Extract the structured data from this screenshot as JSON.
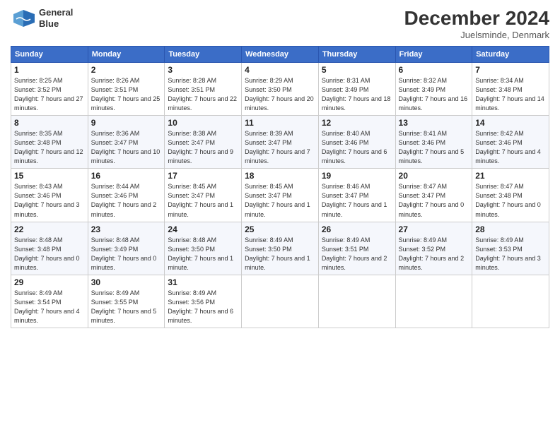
{
  "header": {
    "title": "December 2024",
    "subtitle": "Juelsminde, Denmark",
    "logo_line1": "General",
    "logo_line2": "Blue"
  },
  "days_of_week": [
    "Sunday",
    "Monday",
    "Tuesday",
    "Wednesday",
    "Thursday",
    "Friday",
    "Saturday"
  ],
  "weeks": [
    [
      {
        "day": "1",
        "sunrise": "8:25 AM",
        "sunset": "3:52 PM",
        "daylight": "7 hours and 27 minutes."
      },
      {
        "day": "2",
        "sunrise": "8:26 AM",
        "sunset": "3:51 PM",
        "daylight": "7 hours and 25 minutes."
      },
      {
        "day": "3",
        "sunrise": "8:28 AM",
        "sunset": "3:51 PM",
        "daylight": "7 hours and 22 minutes."
      },
      {
        "day": "4",
        "sunrise": "8:29 AM",
        "sunset": "3:50 PM",
        "daylight": "7 hours and 20 minutes."
      },
      {
        "day": "5",
        "sunrise": "8:31 AM",
        "sunset": "3:49 PM",
        "daylight": "7 hours and 18 minutes."
      },
      {
        "day": "6",
        "sunrise": "8:32 AM",
        "sunset": "3:49 PM",
        "daylight": "7 hours and 16 minutes."
      },
      {
        "day": "7",
        "sunrise": "8:34 AM",
        "sunset": "3:48 PM",
        "daylight": "7 hours and 14 minutes."
      }
    ],
    [
      {
        "day": "8",
        "sunrise": "8:35 AM",
        "sunset": "3:48 PM",
        "daylight": "7 hours and 12 minutes."
      },
      {
        "day": "9",
        "sunrise": "8:36 AM",
        "sunset": "3:47 PM",
        "daylight": "7 hours and 10 minutes."
      },
      {
        "day": "10",
        "sunrise": "8:38 AM",
        "sunset": "3:47 PM",
        "daylight": "7 hours and 9 minutes."
      },
      {
        "day": "11",
        "sunrise": "8:39 AM",
        "sunset": "3:47 PM",
        "daylight": "7 hours and 7 minutes."
      },
      {
        "day": "12",
        "sunrise": "8:40 AM",
        "sunset": "3:46 PM",
        "daylight": "7 hours and 6 minutes."
      },
      {
        "day": "13",
        "sunrise": "8:41 AM",
        "sunset": "3:46 PM",
        "daylight": "7 hours and 5 minutes."
      },
      {
        "day": "14",
        "sunrise": "8:42 AM",
        "sunset": "3:46 PM",
        "daylight": "7 hours and 4 minutes."
      }
    ],
    [
      {
        "day": "15",
        "sunrise": "8:43 AM",
        "sunset": "3:46 PM",
        "daylight": "7 hours and 3 minutes."
      },
      {
        "day": "16",
        "sunrise": "8:44 AM",
        "sunset": "3:46 PM",
        "daylight": "7 hours and 2 minutes."
      },
      {
        "day": "17",
        "sunrise": "8:45 AM",
        "sunset": "3:47 PM",
        "daylight": "7 hours and 1 minute."
      },
      {
        "day": "18",
        "sunrise": "8:45 AM",
        "sunset": "3:47 PM",
        "daylight": "7 hours and 1 minute."
      },
      {
        "day": "19",
        "sunrise": "8:46 AM",
        "sunset": "3:47 PM",
        "daylight": "7 hours and 1 minute."
      },
      {
        "day": "20",
        "sunrise": "8:47 AM",
        "sunset": "3:47 PM",
        "daylight": "7 hours and 0 minutes."
      },
      {
        "day": "21",
        "sunrise": "8:47 AM",
        "sunset": "3:48 PM",
        "daylight": "7 hours and 0 minutes."
      }
    ],
    [
      {
        "day": "22",
        "sunrise": "8:48 AM",
        "sunset": "3:48 PM",
        "daylight": "7 hours and 0 minutes."
      },
      {
        "day": "23",
        "sunrise": "8:48 AM",
        "sunset": "3:49 PM",
        "daylight": "7 hours and 0 minutes."
      },
      {
        "day": "24",
        "sunrise": "8:48 AM",
        "sunset": "3:50 PM",
        "daylight": "7 hours and 1 minute."
      },
      {
        "day": "25",
        "sunrise": "8:49 AM",
        "sunset": "3:50 PM",
        "daylight": "7 hours and 1 minute."
      },
      {
        "day": "26",
        "sunrise": "8:49 AM",
        "sunset": "3:51 PM",
        "daylight": "7 hours and 2 minutes."
      },
      {
        "day": "27",
        "sunrise": "8:49 AM",
        "sunset": "3:52 PM",
        "daylight": "7 hours and 2 minutes."
      },
      {
        "day": "28",
        "sunrise": "8:49 AM",
        "sunset": "3:53 PM",
        "daylight": "7 hours and 3 minutes."
      }
    ],
    [
      {
        "day": "29",
        "sunrise": "8:49 AM",
        "sunset": "3:54 PM",
        "daylight": "7 hours and 4 minutes."
      },
      {
        "day": "30",
        "sunrise": "8:49 AM",
        "sunset": "3:55 PM",
        "daylight": "7 hours and 5 minutes."
      },
      {
        "day": "31",
        "sunrise": "8:49 AM",
        "sunset": "3:56 PM",
        "daylight": "7 hours and 6 minutes."
      },
      null,
      null,
      null,
      null
    ]
  ],
  "labels": {
    "sunrise": "Sunrise:",
    "sunset": "Sunset:",
    "daylight": "Daylight:"
  }
}
